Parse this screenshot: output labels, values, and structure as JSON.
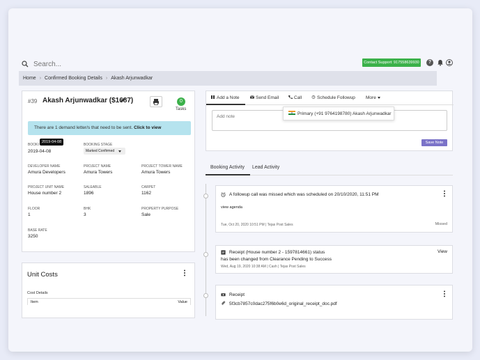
{
  "search": {
    "placeholder": "Search..."
  },
  "header": {
    "contact_support": "Contact Support: 917558639930",
    "help_label": "?"
  },
  "breadcrumb": [
    "Home",
    "Confirmed Booking Details",
    "Akash Arjunwadkar"
  ],
  "booking": {
    "id": "#39",
    "name": "Akash Arjunwadkar ($1687)",
    "tasks_count": "0",
    "tasks_label": "Tasks",
    "alert_text": "There are 1 demand letter/s that need to be sent. ",
    "alert_link": "Click to view",
    "tooltip": "2019-04-08",
    "booking_date_label": "BOOKING DATE",
    "booking_date_label_visible": "BOOKI",
    "booking_date": "2019-04-08",
    "booking_stage_label": "BOOKING STAGE",
    "booking_stage": "Marked Confirmed",
    "developer_name_label": "DEVELOPER NAME",
    "developer_name": "Amura Developers",
    "project_name_label": "PROJECT NAME",
    "project_name": "Amura Towers",
    "project_tower_name_label": "PROJECT TOWER NAME",
    "project_tower_name": "Amura Towers",
    "project_unit_name_label": "PROJECT UNIT NAME",
    "project_unit_name": "House number 2",
    "saleable_label": "SALEABLE",
    "saleable": "1896",
    "carpet_label": "CARPET",
    "carpet": "1162",
    "floor_label": "FLOOR",
    "floor": "1",
    "bhk_label": "BHK",
    "bhk": "3",
    "property_purpose_label": "PROPERTY PURPOSE",
    "property_purpose": "Sale",
    "base_rate_label": "BASE RATE",
    "base_rate": "3250"
  },
  "unit_costs": {
    "title": "Unit Costs",
    "subtitle": "Cost Details",
    "col_item": "Item",
    "col_value": "Value"
  },
  "actions": {
    "tabs": [
      "Add a Note",
      "Send Email",
      "Call",
      "Schedule Followup",
      "More"
    ],
    "note_placeholder": "Add note",
    "save_note": "Save Note",
    "call_option": "Primary (+91 9764198780) Akash Arjunwadkar"
  },
  "activity": {
    "tabs": [
      "Booking Activity",
      "Lead Activity"
    ],
    "items": [
      {
        "title": "A followup call was missed which was scheduled on 20/10/2020, 11:51 PM",
        "body": "view agenda",
        "meta": "Tue, Oct 20, 2020 10:51 PM  |  Tejas Post Sales",
        "status": "Missed"
      },
      {
        "title": "Receipt (House number 2 - 1597814661) status",
        "title2": "has been changed from Clearance Pending to Success",
        "meta": "Wed, Aug 19, 2020 10:38 AM  |  Cash  |  Tejas Post Sales",
        "action": "View"
      },
      {
        "title": "Receipt",
        "body": "5f3cb7857c0dac275f6b0e6d_original_receipt_doc.pdf"
      }
    ]
  },
  "colors": {
    "accent_green": "#3bb14a",
    "save_purple": "#7b73c8",
    "alert_blue": "#b5e3ee"
  }
}
